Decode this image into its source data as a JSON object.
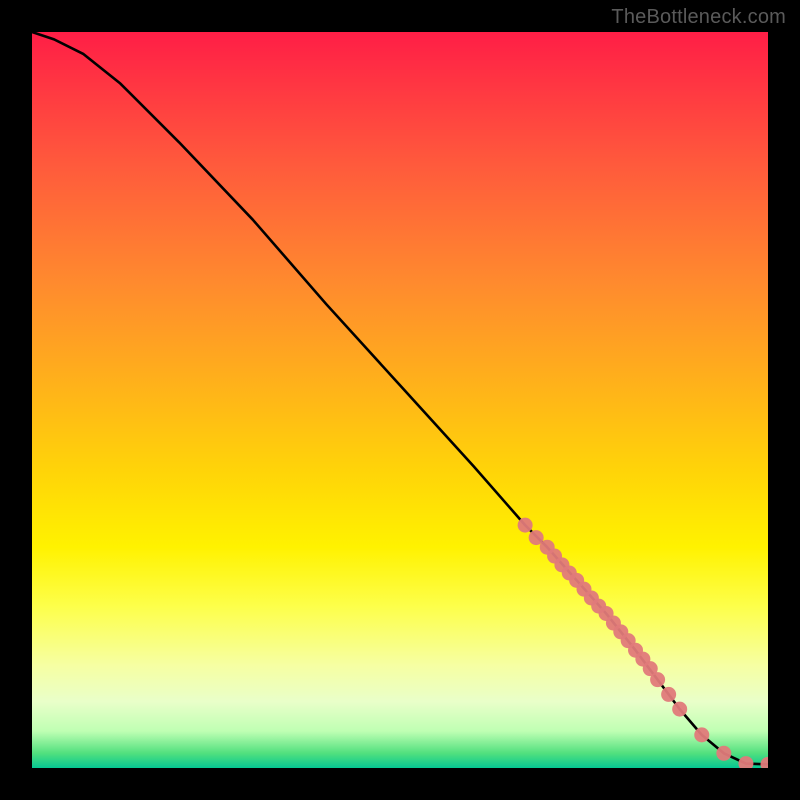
{
  "watermark": "TheBottleneck.com",
  "chart_data": {
    "type": "line",
    "title": "",
    "xlabel": "",
    "ylabel": "",
    "xlim": [
      0,
      100
    ],
    "ylim": [
      0,
      100
    ],
    "series": [
      {
        "name": "curve",
        "style": "line",
        "color": "#000000",
        "x": [
          0,
          3,
          7,
          12,
          20,
          30,
          40,
          50,
          60,
          67,
          70,
          74,
          78,
          82,
          86.5,
          88,
          91,
          94,
          97,
          100
        ],
        "y": [
          100,
          99,
          97,
          93,
          85,
          74.5,
          63,
          52,
          41,
          33,
          30,
          25.5,
          21,
          16,
          10,
          8,
          4.5,
          2,
          0.6,
          0.5
        ]
      },
      {
        "name": "markers",
        "style": "points",
        "color": "#e07a7a",
        "x": [
          67,
          68.5,
          70,
          71,
          72,
          73,
          74,
          75,
          76,
          77,
          78,
          79,
          80,
          81,
          82,
          83,
          84,
          85,
          86.5,
          88,
          91,
          94,
          97,
          100
        ],
        "y": [
          33,
          31.3,
          30,
          28.8,
          27.6,
          26.5,
          25.5,
          24.3,
          23.1,
          22,
          21,
          19.7,
          18.5,
          17.3,
          16,
          14.8,
          13.5,
          12,
          10,
          8,
          4.5,
          2,
          0.6,
          0.5
        ]
      }
    ],
    "grid": false,
    "legend": false
  }
}
